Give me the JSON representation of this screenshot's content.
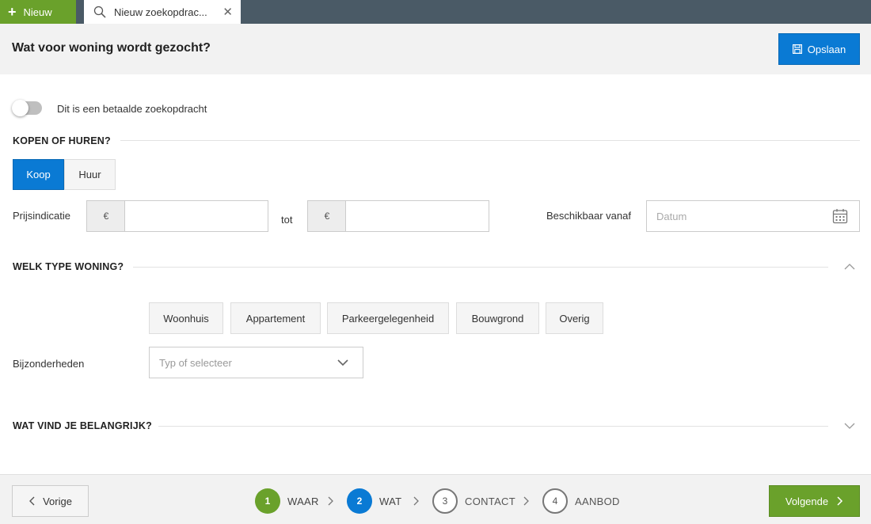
{
  "topbar": {
    "new_label": "Nieuw",
    "tab_label": "Nieuw zoekopdrac...",
    "colors": {
      "bar": "#4a5a66",
      "new": "#6aa12b"
    }
  },
  "header": {
    "title": "Wat voor woning wordt gezocht?",
    "save_label": "Opslaan"
  },
  "paid_toggle": {
    "label": "Dit is een betaalde zoekopdracht",
    "on": false
  },
  "buy_rent": {
    "section_title": "KOPEN OF HUREN?",
    "options": [
      "Koop",
      "Huur"
    ],
    "selected": "Koop"
  },
  "price": {
    "label": "Prijsindicatie",
    "currency": "€",
    "to_label": "tot",
    "from_value": "",
    "to_value": ""
  },
  "available": {
    "label": "Beschikbaar vanaf",
    "placeholder": "Datum"
  },
  "home_type": {
    "section_title": "WELK TYPE WONING?",
    "options": [
      "Woonhuis",
      "Appartement",
      "Parkeergelegenheid",
      "Bouwgrond",
      "Overig"
    ],
    "details_label": "Bijzonderheden",
    "details_placeholder": "Typ of selecteer"
  },
  "important": {
    "section_title": "WAT VIND JE BELANGRIJK?"
  },
  "footer": {
    "prev_label": "Vorige",
    "next_label": "Volgende",
    "steps": [
      {
        "number": "1",
        "label": "WAAR",
        "state": "done"
      },
      {
        "number": "2",
        "label": "WAT",
        "state": "current"
      },
      {
        "number": "3",
        "label": "CONTACT",
        "state": "todo"
      },
      {
        "number": "4",
        "label": "AANBOD",
        "state": "todo"
      }
    ]
  },
  "colors": {
    "primary": "#0a7ad4",
    "success": "#6aa12b"
  }
}
